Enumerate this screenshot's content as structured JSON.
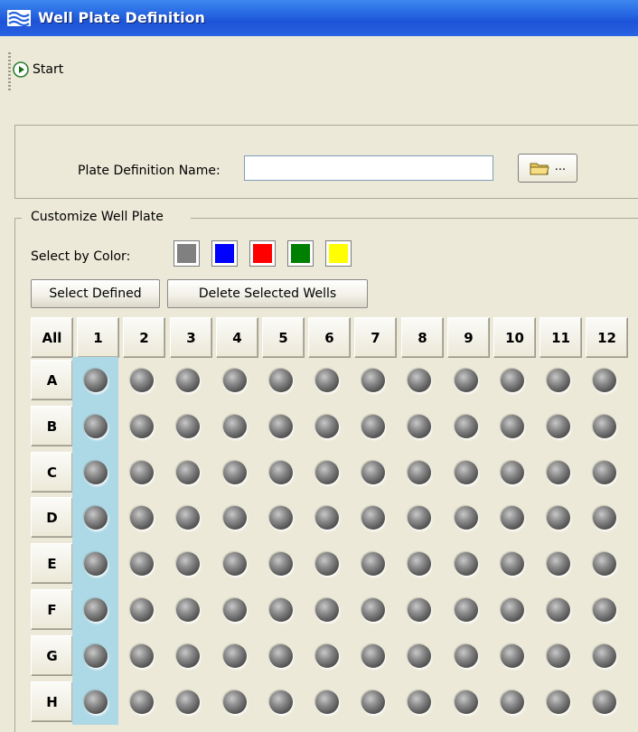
{
  "window": {
    "title": "Well Plate Definition"
  },
  "toolbar": {
    "start_label": "Start"
  },
  "plate_definition": {
    "name_label": "Plate Definition Name:",
    "name_value": "",
    "browse_label": "..."
  },
  "customize": {
    "legend": "Customize Well Plate",
    "select_by_color_label": "Select by Color:",
    "colors": [
      "#808080",
      "#0000ff",
      "#ff0000",
      "#008000",
      "#ffff00"
    ],
    "select_defined_label": "Select Defined",
    "delete_selected_label": "Delete Selected Wells"
  },
  "plate": {
    "all_label": "All",
    "columns": [
      "1",
      "2",
      "3",
      "4",
      "5",
      "6",
      "7",
      "8",
      "9",
      "10",
      "11",
      "12"
    ],
    "rows": [
      "A",
      "B",
      "C",
      "D",
      "E",
      "F",
      "G",
      "H"
    ],
    "selected_column": "1",
    "selection_color": "#add8e6"
  }
}
